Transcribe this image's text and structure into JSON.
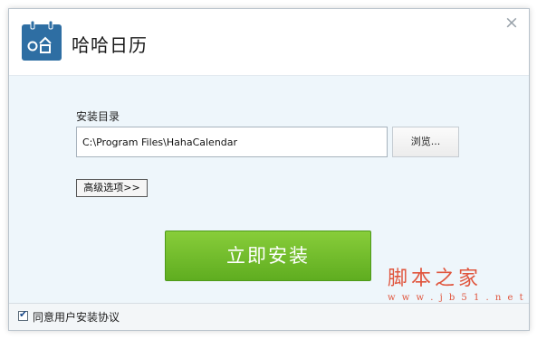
{
  "app": {
    "title": "哈哈日历"
  },
  "install": {
    "dir_label": "安装目录",
    "path_value": "C:\\Program Files\\HahaCalendar",
    "browse_label": "浏览...",
    "advanced_label": "高级选项>>",
    "install_label": "立即安装"
  },
  "footer": {
    "agree_checked": true,
    "agree_label": "同意用户安装协议"
  },
  "window": {
    "close_symbol": "×"
  },
  "watermark": {
    "title": "脚本之家",
    "url": "w w w . j b 5 1 . n e t"
  },
  "colors": {
    "accent_blue": "#2e6ea3",
    "install_green": "#6cbb28",
    "content_bg": "#eef6fb",
    "watermark": "#e0553d"
  }
}
